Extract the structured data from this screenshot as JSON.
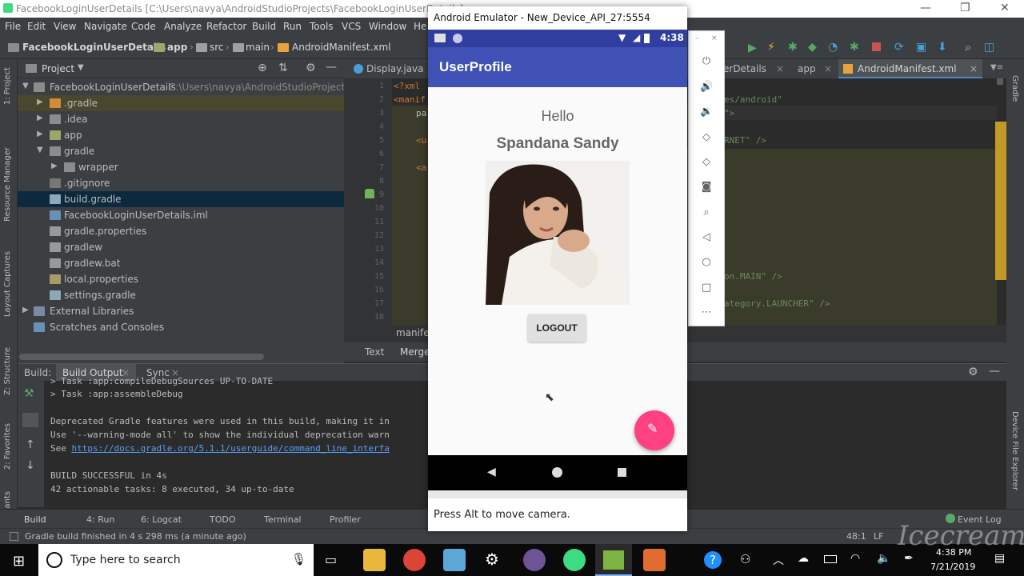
{
  "ide": {
    "title": "FacebookLoginUserDetails [C:\\Users\\navya\\AndroidStudioProjects\\FacebookLoginUserDetails] - ...",
    "menu": [
      "File",
      "Edit",
      "View",
      "Navigate",
      "Code",
      "Analyze",
      "Refactor",
      "Build",
      "Run",
      "Tools",
      "VCS",
      "Window",
      "He"
    ],
    "breadcrumbs": [
      "FacebookLoginUserDetails",
      "app",
      "src",
      "main",
      "AndroidManifest.xml"
    ],
    "project_panel": {
      "title": "Project",
      "root": "FacebookLoginUserDetails",
      "root_path": "C:\\Users\\navya\\AndroidStudioProjects\\Fa",
      "items": [
        ".gradle",
        ".idea",
        "app",
        "gradle",
        "wrapper",
        ".gitignore",
        "build.gradle",
        "FacebookLoginUserDetails.iml",
        "gradle.properties",
        "gradlew",
        "gradlew.bat",
        "local.properties",
        "settings.gradle",
        "External Libraries",
        "Scratches and Consoles"
      ]
    },
    "editor_tabs": [
      "Display.java",
      "erDetails",
      "app",
      "AndroidManifest.xml"
    ],
    "line_numbers": [
      "1",
      "2",
      "3",
      "4",
      "5",
      "6",
      "7",
      "8",
      "9",
      "10",
      "11",
      "12",
      "13",
      "14",
      "15",
      "16",
      "17",
      "18"
    ],
    "code_left": [
      "<?xml",
      "<manif",
      "pa",
      "",
      "<u",
      "",
      "<a"
    ],
    "code_right": [
      "es/android\"",
      "\">",
      "",
      "RNET\" />",
      "on.MAIN\" />",
      "ategory.LAUNCHER\" />"
    ],
    "breadcrumb_bottom": "manifes",
    "bottom_tabs": [
      "Text",
      "Merge"
    ],
    "build": {
      "tabs": [
        "Build:",
        "Build Output",
        "Sync"
      ],
      "lines": [
        "> Task :app:compileDebugSources UP-TO-DATE",
        "> Task :app:assembleDebug",
        "",
        "Deprecated Gradle features were used in this build, making it in",
        "Use '--warning-mode all' to show the individual deprecation warn",
        "See https://docs.gradle.org/5.1.1/userguide/command_line_interfa",
        "",
        "BUILD SUCCESSFUL in 4s",
        "42 actionable tasks: 8 executed, 34 up-to-date"
      ],
      "link": "https://docs.gradle.org/5.1.1/userguide/command_line_interfa"
    },
    "tool_tabs": [
      "Build",
      "4: Run",
      "6: Logcat",
      "TODO",
      "Terminal",
      "Profiler",
      "Event Log"
    ],
    "left_strip": [
      "1: Project",
      "Resource Manager",
      "Layout Captures",
      "Z: Structure",
      "2: Favorites",
      "Build Variants"
    ],
    "right_strip": [
      "Gradle",
      "Device File Explorer"
    ],
    "status": "Gradle build finished in 4 s 298 ms (a minute ago)",
    "status_right": "48:1",
    "status_right2": "LF"
  },
  "emulator": {
    "window_title": "Android Emulator - New_Device_API_27:5554",
    "time": "4:38",
    "app_title": "UserProfile",
    "greeting": "Hello",
    "user_name": "Spandana Sandy",
    "logout": "LOGOUT",
    "hint": "Press Alt to move camera.",
    "accent": "#3f51b5",
    "fab_color": "#ff4081"
  },
  "taskbar": {
    "search_placeholder": "Type here to search",
    "time": "4:38 PM",
    "date": "7/21/2019"
  },
  "watermark": "Icecream"
}
